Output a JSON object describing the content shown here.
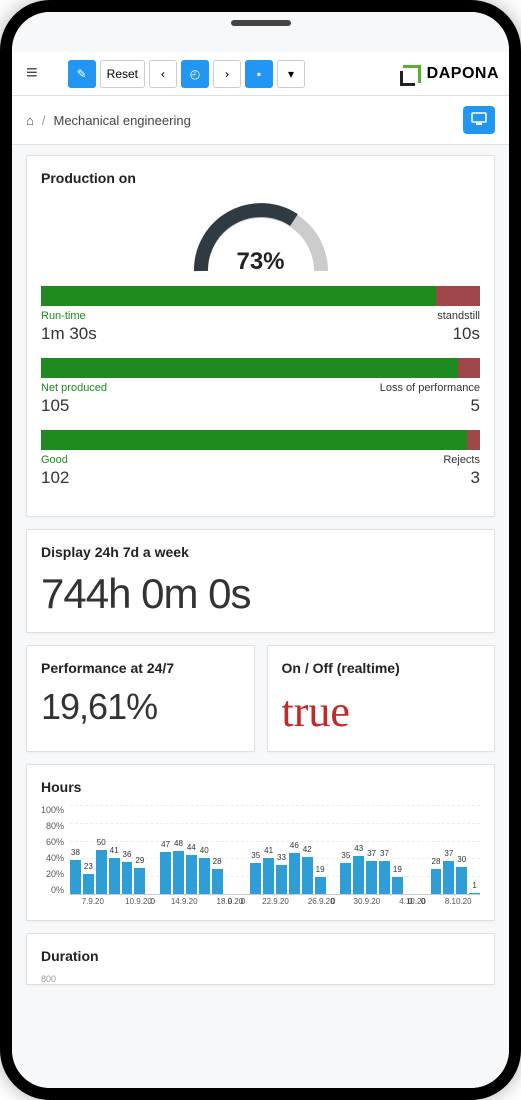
{
  "toolbar": {
    "reset_label": "Reset"
  },
  "brand": "DAPONA",
  "breadcrumb": {
    "home": "⌂",
    "sep": "/",
    "page": "Mechanical engineering"
  },
  "production": {
    "title": "Production on",
    "gauge_percent": "73%",
    "gauge_value": 73,
    "bars": [
      {
        "left_label": "Run-time",
        "left_value": "1m 30s",
        "right_label": "standstill",
        "right_value": "10s",
        "green_pct": 90,
        "red_pct": 10
      },
      {
        "left_label": "Net produced",
        "left_value": "105",
        "right_label": "Loss of performance",
        "right_value": "5",
        "green_pct": 95,
        "red_pct": 5
      },
      {
        "left_label": "Good",
        "left_value": "102",
        "right_label": "Rejects",
        "right_value": "3",
        "green_pct": 97,
        "red_pct": 3
      }
    ]
  },
  "display_card": {
    "title": "Display 24h 7d a week",
    "value": "744h 0m 0s"
  },
  "performance_card": {
    "title": "Performance at 24/7",
    "value": "19,61%"
  },
  "onoff_card": {
    "title": "On / Off (realtime)",
    "value": "true"
  },
  "hours_card": {
    "title": "Hours",
    "y_ticks": [
      "100%",
      "80%",
      "60%",
      "40%",
      "20%",
      "0%"
    ]
  },
  "duration_card": {
    "title": "Duration",
    "y0": "800"
  },
  "chart_data": {
    "type": "bar",
    "title": "Hours",
    "ylabel": "%",
    "ylim": [
      0,
      100
    ],
    "categories": [
      "7.9.20",
      "",
      "",
      "10.9.20",
      "",
      "",
      "",
      "14.9.20",
      "",
      "",
      "",
      "18.9.20",
      "",
      "",
      "",
      "22.9.20",
      "",
      "",
      "",
      "26.9.20",
      "",
      "",
      "",
      "30.9.20",
      "",
      "",
      "",
      "4.10.20",
      "",
      "",
      "",
      "8.10.20"
    ],
    "values": [
      38,
      23,
      50,
      41,
      36,
      29,
      0,
      47,
      48,
      44,
      40,
      28,
      0,
      0,
      35,
      41,
      33,
      46,
      42,
      19,
      0,
      35,
      43,
      37,
      37,
      19,
      0,
      0,
      28,
      37,
      30,
      1
    ],
    "x_ticks": [
      "7.9.20",
      "10.9.20",
      "14.9.20",
      "18.9.20",
      "22.9.20",
      "26.9.20",
      "30.9.20",
      "4.10.20",
      "8.10.20"
    ]
  }
}
